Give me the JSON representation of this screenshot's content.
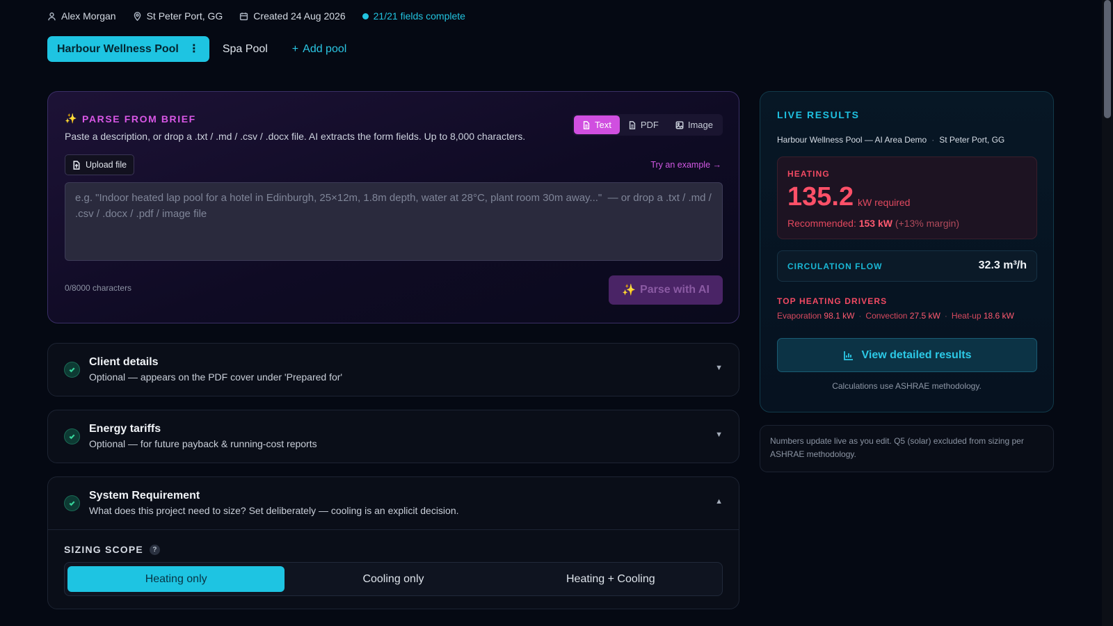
{
  "meta": {
    "user": "Alex Morgan",
    "location": "St Peter Port, GG",
    "created": "Created 24 Aug 2026",
    "status": "21/21 fields complete"
  },
  "pool_tabs": {
    "active": "Harbour Wellness Pool",
    "other": "Spa Pool",
    "add": "Add pool"
  },
  "parse": {
    "title": "PARSE FROM BRIEF",
    "description": "Paste a description, or drop a .txt / .md / .csv / .docx file. AI extracts the form fields. Up to 8,000 characters.",
    "modes": [
      "Text",
      "PDF",
      "Image"
    ],
    "active_mode": "Text",
    "upload_label": "Upload file",
    "try_example": "Try an example →",
    "placeholder": "e.g. \"Indoor heated lap pool for a hotel in Edinburgh, 25×12m, 1.8m depth, water at 28°C, plant room 30m away...\"  — or drop a .txt / .md / .csv / .docx / .pdf / image file",
    "char_count": "0/8000 characters",
    "parse_button": "Parse with AI"
  },
  "sections": [
    {
      "title": "Client details",
      "subtitle": "Optional — appears on the PDF cover under 'Prepared for'",
      "state": "collapsed"
    },
    {
      "title": "Energy tariffs",
      "subtitle": "Optional — for future payback & running-cost reports",
      "state": "collapsed"
    },
    {
      "title": "System Requirement",
      "subtitle": "What does this project need to size? Set deliberately — cooling is an explicit decision.",
      "state": "expanded"
    }
  ],
  "sizing": {
    "label": "SIZING SCOPE",
    "help": "?",
    "options": [
      "Heating only",
      "Cooling only",
      "Heating + Cooling"
    ],
    "selected": "Heating only"
  },
  "live": {
    "title": "LIVE RESULTS",
    "project": "Harbour Wellness Pool — AI Area Demo",
    "location": "St Peter Port, GG",
    "heating_label": "HEATING",
    "heating_value": "135.2",
    "heating_unit": "kW required",
    "recommended_label": "Recommended:",
    "recommended_value": "153 kW",
    "recommended_margin": "(+13% margin)",
    "flow_label": "CIRCULATION FLOW",
    "flow_value": "32.3 m³/h",
    "drivers_label": "TOP HEATING DRIVERS",
    "drivers": [
      {
        "name": "Evaporation",
        "value": "98.1 kW"
      },
      {
        "name": "Convection",
        "value": "27.5 kW"
      },
      {
        "name": "Heat-up",
        "value": "18.6 kW"
      }
    ],
    "view_button": "View detailed results",
    "methodology": "Calculations use ASHRAE methodology."
  },
  "note": "Numbers update live as you edit. Q5 (solar) excluded from sizing per ASHRAE methodology.",
  "colors": {
    "accent": "#1ec4e2",
    "magenta": "#d04fe0",
    "heating": "#ff5068"
  }
}
